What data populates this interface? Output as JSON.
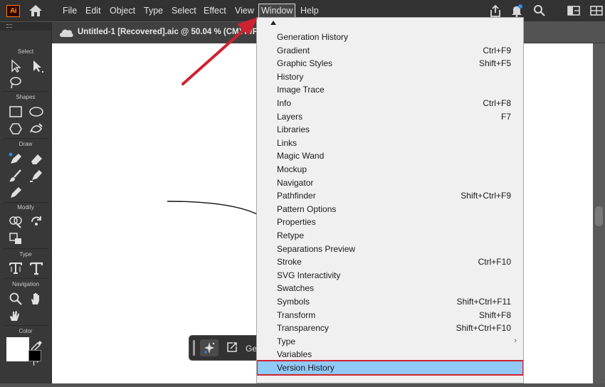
{
  "app": {
    "logo_text": "Ai",
    "menus": [
      "File",
      "Edit",
      "Object",
      "Type",
      "Select",
      "Effect",
      "View",
      "Window",
      "Help"
    ],
    "active_menu": "Window"
  },
  "document": {
    "tab_title": "Untitled-1 [Recovered].aic @ 50.04 % (CMYK/Pre"
  },
  "toolbar": {
    "sections": [
      "Select",
      "Shapes",
      "Draw",
      "Modify",
      "Type",
      "Navigation",
      "Color"
    ]
  },
  "context_bar": {
    "text": "Ge"
  },
  "window_menu": {
    "items": [
      {
        "label": "Generation History",
        "shortcut": ""
      },
      {
        "label": "Gradient",
        "shortcut": "Ctrl+F9"
      },
      {
        "label": "Graphic Styles",
        "shortcut": "Shift+F5"
      },
      {
        "label": "History",
        "shortcut": ""
      },
      {
        "label": "Image Trace",
        "shortcut": ""
      },
      {
        "label": "Info",
        "shortcut": "Ctrl+F8"
      },
      {
        "label": "Layers",
        "shortcut": "F7"
      },
      {
        "label": "Libraries",
        "shortcut": ""
      },
      {
        "label": "Links",
        "shortcut": ""
      },
      {
        "label": "Magic Wand",
        "shortcut": ""
      },
      {
        "label": "Mockup",
        "shortcut": ""
      },
      {
        "label": "Navigator",
        "shortcut": ""
      },
      {
        "label": "Pathfinder",
        "shortcut": "Shift+Ctrl+F9"
      },
      {
        "label": "Pattern Options",
        "shortcut": ""
      },
      {
        "label": "Properties",
        "shortcut": ""
      },
      {
        "label": "Retype",
        "shortcut": ""
      },
      {
        "label": "Separations Preview",
        "shortcut": ""
      },
      {
        "label": "Stroke",
        "shortcut": "Ctrl+F10"
      },
      {
        "label": "SVG Interactivity",
        "shortcut": ""
      },
      {
        "label": "Swatches",
        "shortcut": ""
      },
      {
        "label": "Symbols",
        "shortcut": "Shift+Ctrl+F11"
      },
      {
        "label": "Transform",
        "shortcut": "Shift+F8"
      },
      {
        "label": "Transparency",
        "shortcut": "Shift+Ctrl+F10"
      },
      {
        "label": "Type",
        "shortcut": ""
      },
      {
        "label": "Variables",
        "shortcut": ""
      },
      {
        "label": "Version History",
        "shortcut": ""
      }
    ],
    "highlighted": "Version History"
  },
  "colors": {
    "menu_highlight": "#91c9f7",
    "annotation_red": "#cf2230",
    "ui_dark": "#323232"
  }
}
